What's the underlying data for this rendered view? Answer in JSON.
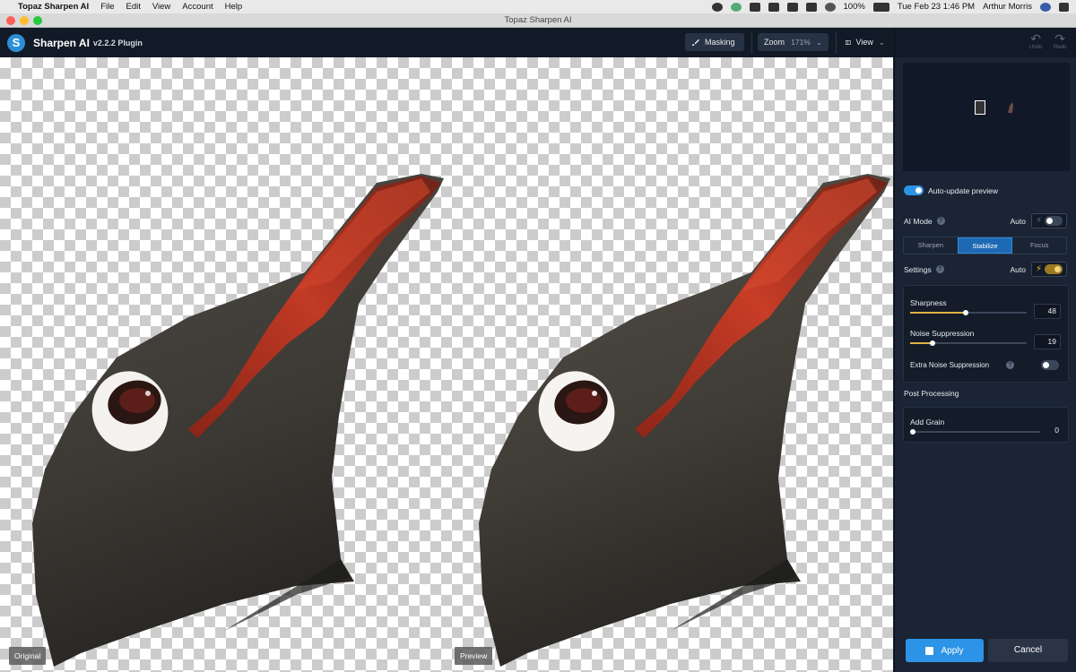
{
  "menubar": {
    "app_name": "Topaz Sharpen AI",
    "items": [
      "File",
      "Edit",
      "View",
      "Account",
      "Help"
    ],
    "battery": "100%",
    "datetime": "Tue Feb 23  1:46 PM",
    "user": "Arthur Morris"
  },
  "window": {
    "title": "Topaz Sharpen AI"
  },
  "header": {
    "app_title": "Sharpen AI",
    "version": "v2.2.2 Plugin",
    "masking_label": "Masking",
    "zoom_label": "Zoom",
    "zoom_value": "171%",
    "view_label": "View",
    "undo_label": "Undo",
    "redo_label": "Redo"
  },
  "canvas": {
    "original_label": "Original",
    "preview_label": "Preview"
  },
  "panel": {
    "auto_update_label": "Auto-update preview",
    "auto_update_on": true,
    "ai_mode_label": "AI Mode",
    "ai_mode_auto_label": "Auto",
    "ai_mode_auto_on": false,
    "modes": [
      "Sharpen",
      "Stabilize",
      "Focus"
    ],
    "active_mode": "Stabilize",
    "settings_label": "Settings",
    "settings_auto_label": "Auto",
    "settings_auto_on": true,
    "sharpness_label": "Sharpness",
    "sharpness_value": "48",
    "sharpness_fraction": 0.48,
    "noise_label": "Noise Suppression",
    "noise_value": "19",
    "noise_fraction": 0.19,
    "extra_noise_label": "Extra Noise Suppression",
    "extra_noise_on": false,
    "post_processing_label": "Post Processing",
    "grain_label": "Add Grain",
    "grain_value": "0",
    "grain_fraction": 0.0,
    "apply_label": "Apply",
    "cancel_label": "Cancel"
  },
  "colors": {
    "accent": "#2d93e6",
    "auto_active": "#e0b341",
    "panel_bg": "#1b2434"
  }
}
